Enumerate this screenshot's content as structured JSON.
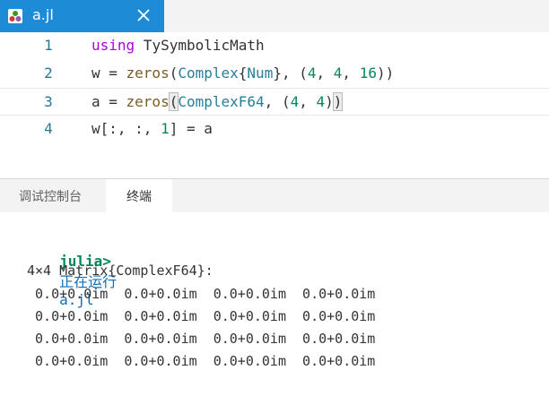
{
  "tab": {
    "title": "a.jl",
    "close_glyph": "✕"
  },
  "editor": {
    "lines": [
      {
        "num": "1",
        "tokens": [
          [
            "kw",
            "using"
          ],
          [
            "plain",
            " TySymbolicMath"
          ]
        ]
      },
      {
        "num": "2",
        "tokens": [
          [
            "plain",
            "w = "
          ],
          [
            "fn",
            "zeros"
          ],
          [
            "br",
            "("
          ],
          [
            "ty",
            "Complex"
          ],
          [
            "br",
            "{"
          ],
          [
            "ty",
            "Num"
          ],
          [
            "br",
            "}"
          ],
          [
            "plain",
            ", "
          ],
          [
            "br",
            "("
          ],
          [
            "nm",
            "4"
          ],
          [
            "plain",
            ", "
          ],
          [
            "nm",
            "4"
          ],
          [
            "plain",
            ", "
          ],
          [
            "nm",
            "16"
          ],
          [
            "br",
            ")"
          ],
          [
            "br",
            ")"
          ]
        ]
      },
      {
        "num": "3",
        "tokens": [
          [
            "plain",
            "a = "
          ],
          [
            "fn",
            "zeros"
          ],
          [
            "bm",
            "("
          ],
          [
            "ty",
            "ComplexF64"
          ],
          [
            "plain",
            ", "
          ],
          [
            "br",
            "("
          ],
          [
            "nm",
            "4"
          ],
          [
            "plain",
            ", "
          ],
          [
            "nm",
            "4"
          ],
          [
            "br",
            ")"
          ],
          [
            "bm",
            ")"
          ]
        ]
      },
      {
        "num": "4",
        "tokens": [
          [
            "plain",
            "w[:, :, "
          ],
          [
            "nm",
            "1"
          ],
          [
            "plain",
            "] = a"
          ]
        ]
      }
    ]
  },
  "panel": {
    "tabs": [
      {
        "label": "调试控制台"
      },
      {
        "label": "终端"
      }
    ],
    "active_tab": 1
  },
  "terminal": {
    "prompt": "julia>",
    "running_text": "正在运行",
    "running_file": "a.jl",
    "matrix_header": "4×4 Matrix{ComplexF64}:",
    "rows": [
      " 0.0+0.0im  0.0+0.0im  0.0+0.0im  0.0+0.0im",
      " 0.0+0.0im  0.0+0.0im  0.0+0.0im  0.0+0.0im",
      " 0.0+0.0im  0.0+0.0im  0.0+0.0im  0.0+0.0im",
      " 0.0+0.0im  0.0+0.0im  0.0+0.0im  0.0+0.0im"
    ]
  },
  "colors": {
    "tab_bg": "#1e8bd6",
    "keyword": "#af00db",
    "function": "#795e26",
    "type": "#267f99",
    "number": "#098658",
    "line_number": "#237893",
    "prompt": "#098658",
    "running": "#0e6eb8"
  }
}
